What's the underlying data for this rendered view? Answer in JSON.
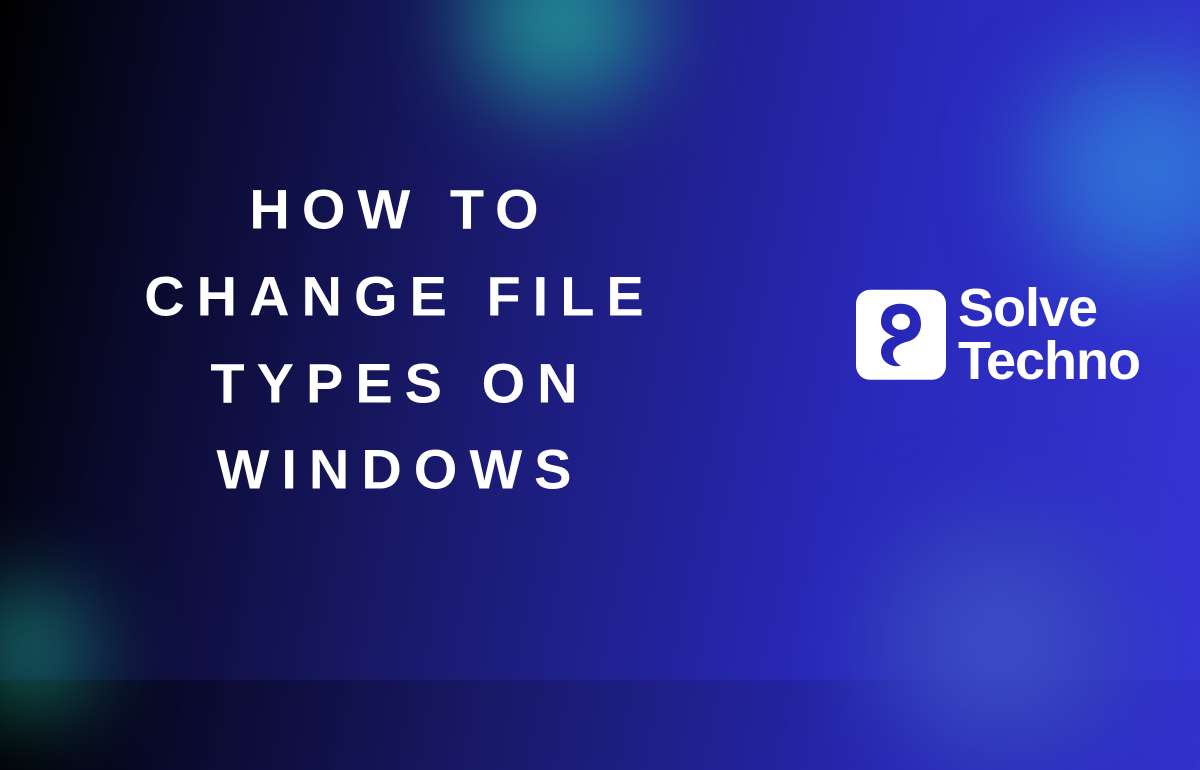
{
  "title": "HOW TO CHANGE FILE TYPES ON WINDOWS",
  "logo": {
    "line1": "Solve",
    "line2": "Techno"
  }
}
